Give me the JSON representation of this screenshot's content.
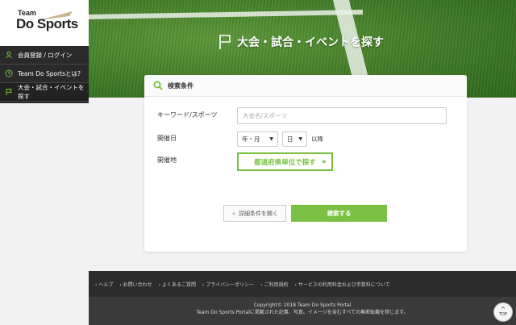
{
  "brand": {
    "team": "Team",
    "name": "Do Sports"
  },
  "sidebar": {
    "items": [
      {
        "label": "会員登録 / ログイン",
        "icon": "user-icon"
      },
      {
        "label": "Team Do Sportsとは?",
        "icon": "clock-icon"
      },
      {
        "label": "大会・試合・イベントを探す",
        "icon": "flag-icon"
      }
    ]
  },
  "hero": {
    "title": "大会・試合・イベントを探す"
  },
  "search": {
    "title": "検索条件",
    "keyword_label": "キーワード/スポーツ",
    "keyword_placeholder": "大会名/スポーツ",
    "date_label": "開催日",
    "month_value": "年・月",
    "day_value": "日",
    "date_suffix": "以降",
    "place_label": "開催地",
    "pref_button": "都道府県単位で探す",
    "detail_button": "詳細条件を開く",
    "submit_button": "検索する"
  },
  "footer": {
    "links": [
      "ヘルプ",
      "お問い合わせ",
      "よくあるご質問",
      "プライバシーポリシー",
      "ご利用規約",
      "サービスの利用料金および手数料について"
    ],
    "copyright": "Copyright© 2018 Team Do Sports Portal",
    "notice": "Team Do Sports Portalに掲載された記事、写真、イメージを含むすべての無断転載を禁じます。",
    "top_label": "TOP"
  },
  "colors": {
    "accent": "#7ac143",
    "sidebar": "#2a2a2a",
    "footer": "#2c2c2c"
  }
}
